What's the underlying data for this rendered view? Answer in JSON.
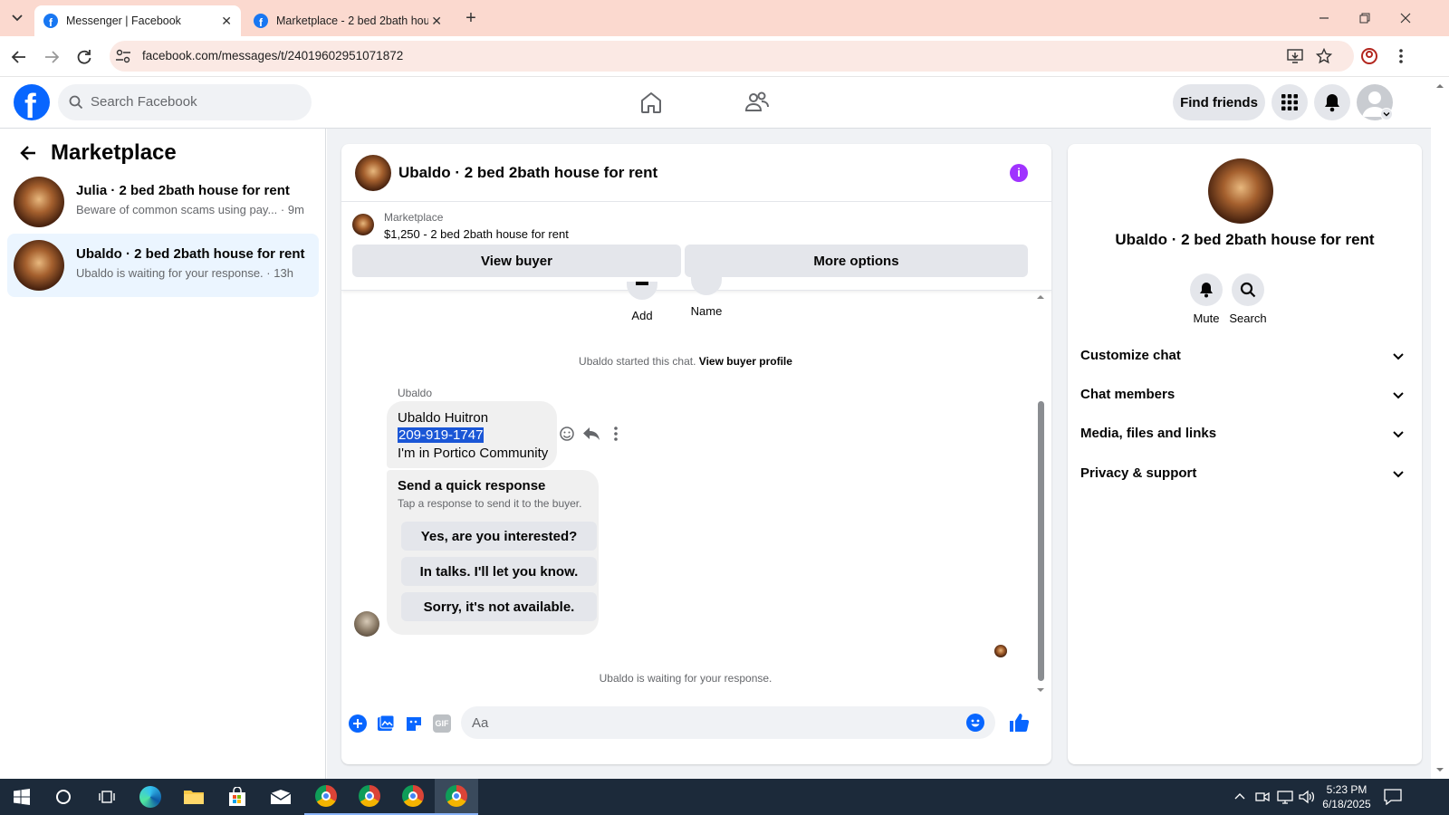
{
  "browser": {
    "tabs": [
      {
        "title": "Messenger | Facebook",
        "active": true
      },
      {
        "title": "Marketplace - 2 bed 2bath hou",
        "active": false
      }
    ],
    "url": "facebook.com/messages/t/24019602951071872"
  },
  "fb_header": {
    "search_placeholder": "Search Facebook",
    "find_friends_label": "Find friends"
  },
  "left_panel": {
    "title": "Marketplace",
    "conversations": [
      {
        "name": "Julia · 2 bed 2bath house for rent",
        "snippet": "Beware of common scams using pay...",
        "time": "· 9m",
        "selected": false
      },
      {
        "name": "Ubaldo · 2 bed 2bath house for rent",
        "snippet": "Ubaldo is waiting for your response.",
        "time": "· 13h",
        "selected": true
      }
    ]
  },
  "chat": {
    "title": "Ubaldo · 2 bed 2bath house for rent",
    "listing_label": "Marketplace",
    "listing_text": "$1,250 - 2 bed 2bath house for rent",
    "view_buyer_label": "View buyer",
    "more_options_label": "More options",
    "add_label": "Add",
    "name_label": "Name",
    "started_text": "Ubaldo started this chat.",
    "view_buyer_profile_label": "View buyer profile",
    "sender_name": "Ubaldo",
    "message_lines": [
      "Ubaldo Huitron",
      "209-919-1747",
      "I'm in Portico Community"
    ],
    "quick_response_title": "Send a quick response",
    "quick_response_subtitle": "Tap a response to send it to the buyer.",
    "quick_responses": [
      "Yes, are you interested?",
      "In talks. I'll let you know.",
      "Sorry, it's not available."
    ],
    "waiting_text": "Ubaldo is waiting for your response.",
    "composer_placeholder": "Aa"
  },
  "info_panel": {
    "title": "Ubaldo · 2 bed 2bath house for rent",
    "mute_label": "Mute",
    "search_label": "Search",
    "sections": [
      "Customize chat",
      "Chat members",
      "Media, files and links",
      "Privacy & support"
    ]
  },
  "taskbar": {
    "time": "5:23 PM",
    "date": "6/18/2025"
  },
  "colors": {
    "fb_blue": "#0866ff",
    "highlight": "#1a56d6",
    "info_purple": "#a033ff"
  }
}
